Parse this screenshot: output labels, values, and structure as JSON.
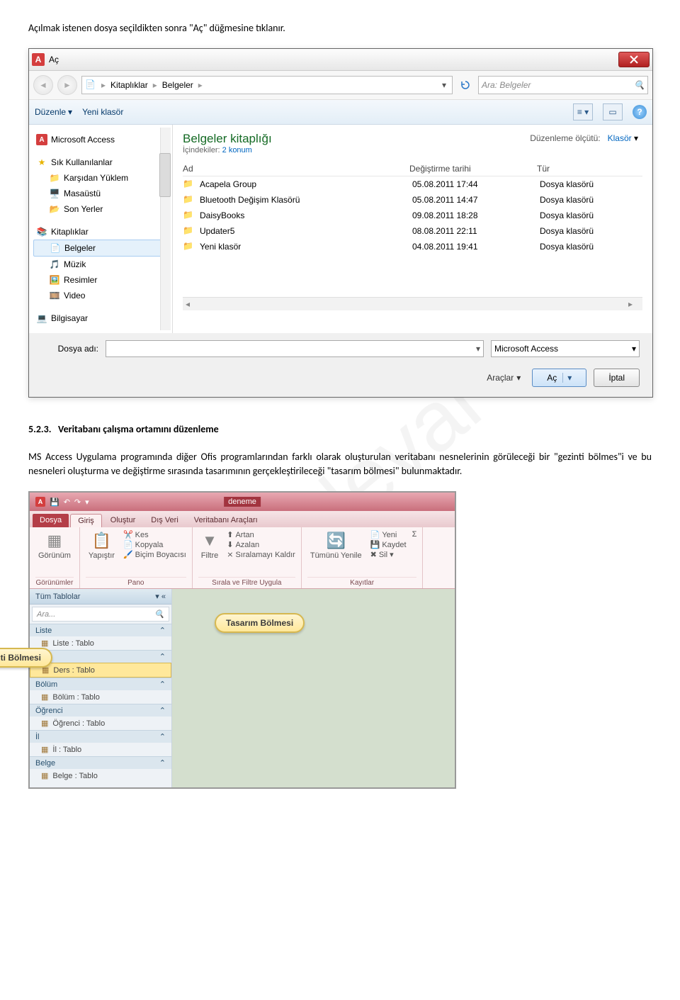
{
  "intro_text": "Açılmak istenen dosya seçildikten sonra \"Aç\" düğmesine tıklanır.",
  "section_number": "5.2.3.",
  "section_title": "Veritabanı çalışma ortamını düzenleme",
  "body_text": "MS Access Uygulama programında diğer Ofis programlarından farklı olarak oluşturulan veritabanı nesnelerinin görüleceği bir \"gezinti bölmes\"i ve bu nesneleri oluşturma ve değiştirme sırasında tasarımının gerçekleştirileceği \"tasarım bölmesi\" bulunmaktadır.",
  "watermark": "Öğr.Gör.Neval BATI",
  "open_dialog": {
    "title": "Aç",
    "breadcrumb": [
      "Kitaplıklar",
      "Belgeler"
    ],
    "search_placeholder": "Ara: Belgeler",
    "organize": "Düzenle",
    "new_folder": "Yeni klasör",
    "tree": {
      "access": "Microsoft Access",
      "favorites": "Sık Kullanılanlar",
      "downloads": "Karşıdan Yüklem",
      "desktop": "Masaüstü",
      "recent": "Son Yerler",
      "libraries": "Kitaplıklar",
      "documents": "Belgeler",
      "music": "Müzik",
      "pictures": "Resimler",
      "video": "Video",
      "computer": "Bilgisayar"
    },
    "library": {
      "title": "Belgeler kitaplığı",
      "sub_label": "İçindekiler:",
      "sub_link": "2 konum",
      "criteria_label": "Düzenleme ölçütü:",
      "criteria_value": "Klasör"
    },
    "columns": {
      "name": "Ad",
      "date": "Değiştirme tarihi",
      "type": "Tür"
    },
    "rows": [
      {
        "name": "Acapela Group",
        "date": "05.08.2011 17:44",
        "type": "Dosya klasörü"
      },
      {
        "name": "Bluetooth Değişim Klasörü",
        "date": "05.08.2011 14:47",
        "type": "Dosya klasörü"
      },
      {
        "name": "DaisyBooks",
        "date": "09.08.2011 18:28",
        "type": "Dosya klasörü"
      },
      {
        "name": "Updater5",
        "date": "08.08.2011 22:11",
        "type": "Dosya klasörü"
      },
      {
        "name": "Yeni klasör",
        "date": "04.08.2011 19:41",
        "type": "Dosya klasörü"
      }
    ],
    "footer": {
      "filename_label": "Dosya adı:",
      "filetype": "Microsoft Access",
      "tools": "Araçlar",
      "open": "Aç",
      "cancel": "İptal"
    }
  },
  "access": {
    "db_name": "deneme",
    "tabs": {
      "file": "Dosya",
      "home": "Giriş",
      "create": "Oluştur",
      "external": "Dış Veri",
      "dbtools": "Veritabanı Araçları"
    },
    "ribbon": {
      "groups": {
        "views": "Görünümler",
        "clipboard": "Pano",
        "sortfilter": "Sırala ve Filtre Uygula",
        "records": "Kayıtlar"
      },
      "view": "Görünüm",
      "paste": "Yapıştır",
      "cut": "Kes",
      "copy": "Kopyala",
      "format_painter": "Biçim Boyacısı",
      "filter": "Filtre",
      "ascending": "Artan",
      "descending": "Azalan",
      "remove_sort": "Sıralamayı Kaldır",
      "refresh_all": "Tümünü Yenile",
      "new": "Yeni",
      "save": "Kaydet",
      "delete": "Sil"
    },
    "nav": {
      "title": "Tüm Tablolar",
      "search": "Ara...",
      "groups": [
        {
          "head": "Liste",
          "items": [
            "Liste : Tablo"
          ]
        },
        {
          "head": "Ders",
          "items": [
            "Ders : Tablo"
          ]
        },
        {
          "head": "Bölüm",
          "items": [
            "Bölüm : Tablo"
          ]
        },
        {
          "head": "Öğrenci",
          "items": [
            "Öğrenci : Tablo"
          ]
        },
        {
          "head": "İl",
          "items": [
            "İl : Tablo"
          ]
        },
        {
          "head": "Belge",
          "items": [
            "Belge : Tablo"
          ]
        }
      ]
    },
    "bubbles": {
      "nav": "Gezinti Bölmesi",
      "design": "Tasarım Bölmesi"
    }
  }
}
